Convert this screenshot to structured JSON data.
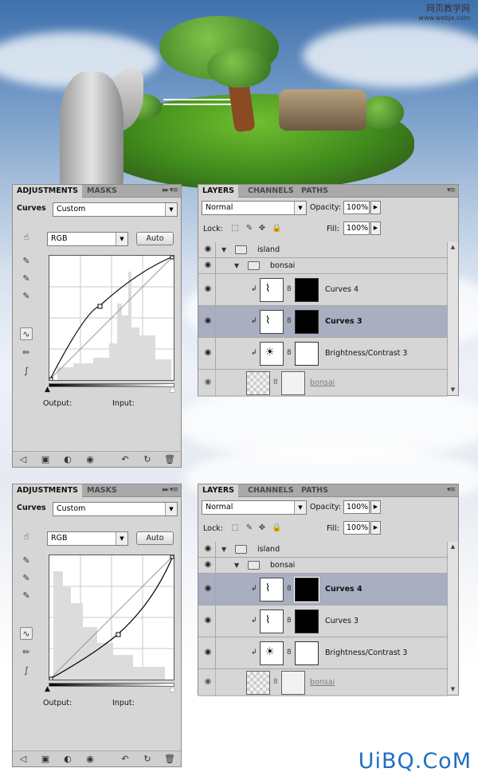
{
  "watermark_top": {
    "line1": "网页教学网",
    "line2": "www.webjx.com"
  },
  "watermark_bottom": "UiBQ.CoM",
  "panels": [
    {
      "adjustments": {
        "tabs": [
          "ADJUSTMENTS",
          "MASKS"
        ],
        "preset_label": "Curves",
        "preset_value": "Custom",
        "channel_value": "RGB",
        "auto_label": "Auto",
        "output_label": "Output:",
        "input_label": "Input:"
      },
      "layers": {
        "tabs": [
          "LAYERS",
          "CHANNELS",
          "PATHS"
        ],
        "blend_mode": "Normal",
        "opacity_label": "Opacity:",
        "opacity_value": "100%",
        "lock_label": "Lock:",
        "fill_label": "Fill:",
        "fill_value": "100%",
        "rows": [
          {
            "name": "island"
          },
          {
            "name": "bonsai"
          },
          {
            "name": "Curves 4"
          },
          {
            "name": "Curves 3"
          },
          {
            "name": "Brightness/Contrast 3"
          },
          {
            "name": "bonsai"
          }
        ]
      }
    },
    {
      "adjustments": {
        "tabs": [
          "ADJUSTMENTS",
          "MASKS"
        ],
        "preset_label": "Curves",
        "preset_value": "Custom",
        "channel_value": "RGB",
        "auto_label": "Auto",
        "output_label": "Output:",
        "input_label": "Input:"
      },
      "layers": {
        "tabs": [
          "LAYERS",
          "CHANNELS",
          "PATHS"
        ],
        "blend_mode": "Normal",
        "opacity_label": "Opacity:",
        "opacity_value": "100%",
        "lock_label": "Lock:",
        "fill_label": "Fill:",
        "fill_value": "100%",
        "rows": [
          {
            "name": "island"
          },
          {
            "name": "bonsai"
          },
          {
            "name": "Curves 4"
          },
          {
            "name": "Curves 3"
          },
          {
            "name": "Brightness/Contrast 3"
          },
          {
            "name": "bonsai"
          }
        ]
      }
    }
  ],
  "icons": {
    "menu": "panel-menu-icon",
    "eye": "visibility-eye-icon",
    "folder": "folder-icon",
    "curves": "curves-adjustment-icon",
    "brightness": "brightness-contrast-icon",
    "link": "chain-link-icon"
  },
  "colors": {
    "selected_row": "#a9aec1",
    "panel_bg": "#d6d6d6",
    "watermark_blue": "#1e6fbf"
  }
}
